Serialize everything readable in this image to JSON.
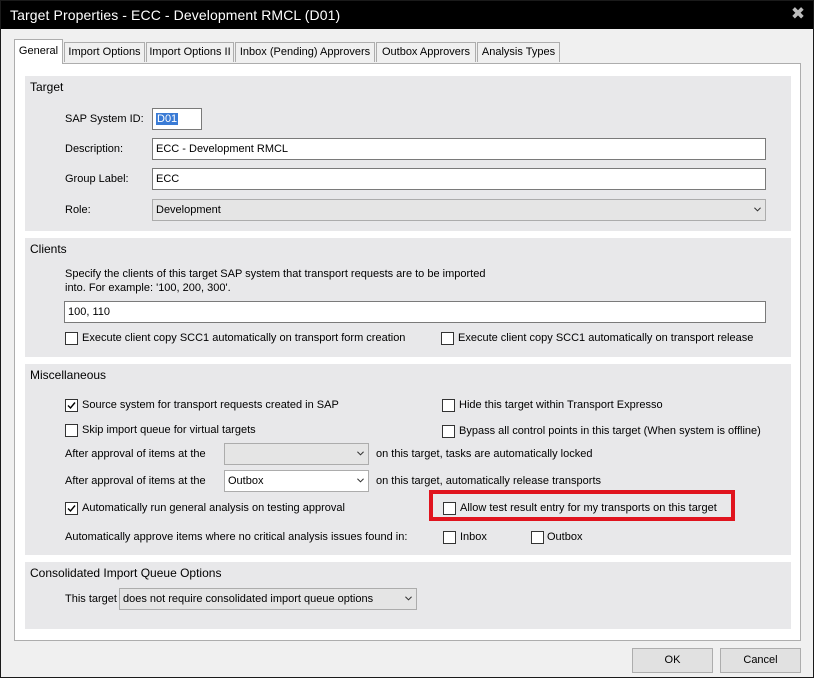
{
  "window": {
    "title": "Target Properties - ECC - Development RMCL (D01)",
    "close_icon": "close-icon"
  },
  "tabs": [
    {
      "label": "General",
      "active": true
    },
    {
      "label": "Import Options",
      "active": false
    },
    {
      "label": "Import Options II",
      "active": false
    },
    {
      "label": "Inbox (Pending) Approvers",
      "active": false
    },
    {
      "label": "Outbox Approvers",
      "active": false
    },
    {
      "label": "Analysis Types",
      "active": false
    }
  ],
  "target": {
    "group_title": "Target",
    "sap_system_id_label": "SAP System ID:",
    "sap_system_id_value": "D01",
    "description_label": "Description:",
    "description_value": "ECC - Development RMCL",
    "group_label_label": "Group Label:",
    "group_label_value": "ECC",
    "role_label": "Role:",
    "role_value": "Development"
  },
  "clients": {
    "group_title": "Clients",
    "help_line1": "Specify the clients of this target SAP system that transport requests are to be imported",
    "help_line2": "into.  For example: '100, 200, 300'.",
    "clients_value": "100, 110",
    "cb_copy_on_creation": {
      "label": "Execute client copy SCC1 automatically on transport form creation",
      "checked": false
    },
    "cb_copy_on_release": {
      "label": "Execute client copy SCC1 automatically on transport release",
      "checked": false
    }
  },
  "misc": {
    "group_title": "Miscellaneous",
    "cb_source_system": {
      "label": "Source system for transport requests created in SAP",
      "checked": true
    },
    "cb_hide_target": {
      "label": "Hide this target within Transport Expresso",
      "checked": false
    },
    "cb_skip_import_queue": {
      "label": "Skip import queue for virtual targets",
      "checked": false
    },
    "cb_bypass_control": {
      "label": "Bypass all control points in this target (When system is offline)",
      "checked": false
    },
    "after_approval_label_1": "After approval of items at the",
    "after_approval_value_1": "",
    "after_approval_suffix_1": "on this target, tasks are automatically locked",
    "after_approval_label_2": "After approval of items at the",
    "after_approval_value_2": "Outbox",
    "after_approval_suffix_2": "on this target, automatically release transports",
    "cb_auto_analysis": {
      "label": "Automatically run general analysis on testing approval",
      "checked": true
    },
    "cb_allow_test_result": {
      "label": "Allow test result entry for my transports on this target",
      "checked": false
    },
    "auto_approve_label": "Automatically approve items where no critical analysis issues found in:",
    "cb_inbox": {
      "label": "Inbox",
      "checked": false
    },
    "cb_outbox": {
      "label": "Outbox",
      "checked": false
    },
    "highlight_color": "#e0141e"
  },
  "consolidated": {
    "group_title": "Consolidated Import Queue Options",
    "this_target_label": "This target",
    "option_value": "does not require consolidated import queue options"
  },
  "footer": {
    "ok_label": "OK",
    "cancel_label": "Cancel"
  }
}
